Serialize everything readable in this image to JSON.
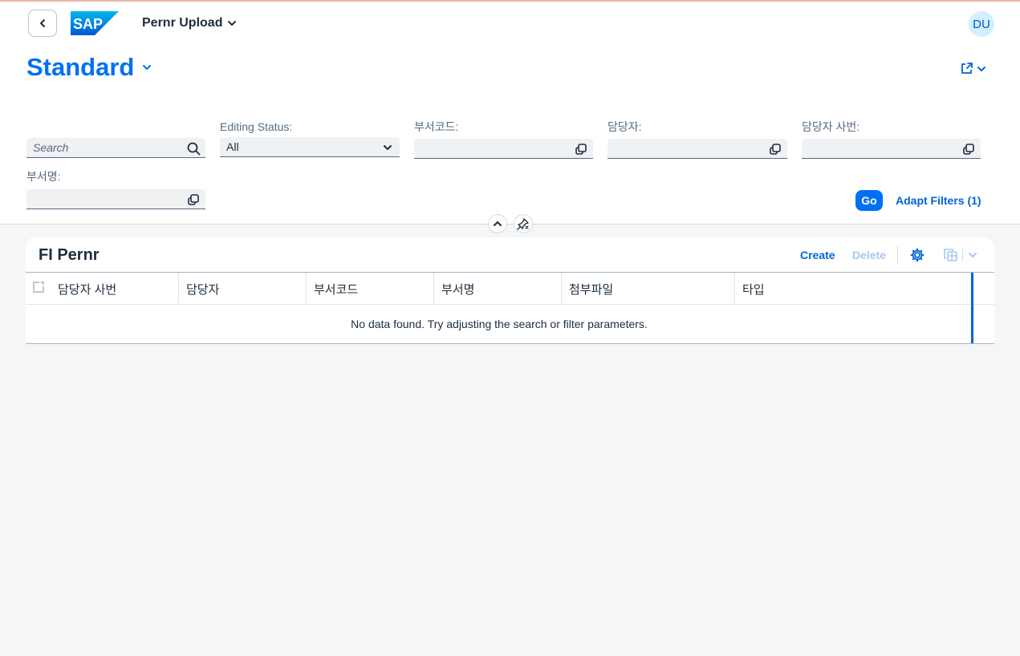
{
  "shell": {
    "app_title": "Pernr Upload",
    "avatar_initials": "DU",
    "logo_text": "SAP",
    "accent_color": "#0070f2"
  },
  "variant": {
    "name": "Standard"
  },
  "filters": {
    "search": {
      "placeholder": "Search",
      "value": ""
    },
    "editing_status": {
      "label": "Editing Status:",
      "value": "All"
    },
    "dept_code": {
      "label": "부서코드:",
      "value": ""
    },
    "manager": {
      "label": "담당자:",
      "value": ""
    },
    "manager_empno": {
      "label": "담당자 사번:",
      "value": ""
    },
    "dept_name": {
      "label": "부서명:",
      "value": ""
    },
    "go_label": "Go",
    "adapt_label": "Adapt Filters (1)"
  },
  "table": {
    "title": "FI Pernr",
    "create_label": "Create",
    "delete_label": "Delete",
    "columns": [
      "담당자 사번",
      "담당자",
      "부서코드",
      "부서명",
      "첨부파일",
      "타입"
    ],
    "empty_text": "No data found. Try adjusting the search or filter parameters."
  }
}
